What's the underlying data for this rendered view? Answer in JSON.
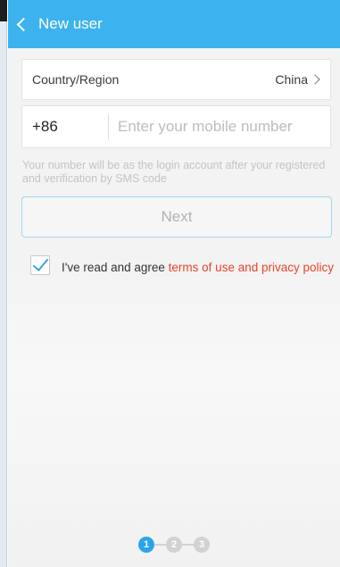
{
  "header": {
    "title": "New user",
    "back_icon": "chevron-left-icon",
    "background": "#3cb2ee"
  },
  "country_row": {
    "label": "Country/Region",
    "value": "China"
  },
  "phone_row": {
    "country_code": "+86",
    "placeholder": "Enter your mobile number",
    "value": ""
  },
  "hint": "Your number will be as the login account after your registered and verification by SMS code",
  "next_button": {
    "label": "Next",
    "enabled": false
  },
  "agreement": {
    "checked": true,
    "prefix": "I've read and agree ",
    "link_text": "terms of use and privacy policy",
    "link_color": "#e8462c"
  },
  "steps": {
    "items": [
      "1",
      "2",
      "3"
    ],
    "current": 1,
    "active_color": "#2aa6e8"
  }
}
